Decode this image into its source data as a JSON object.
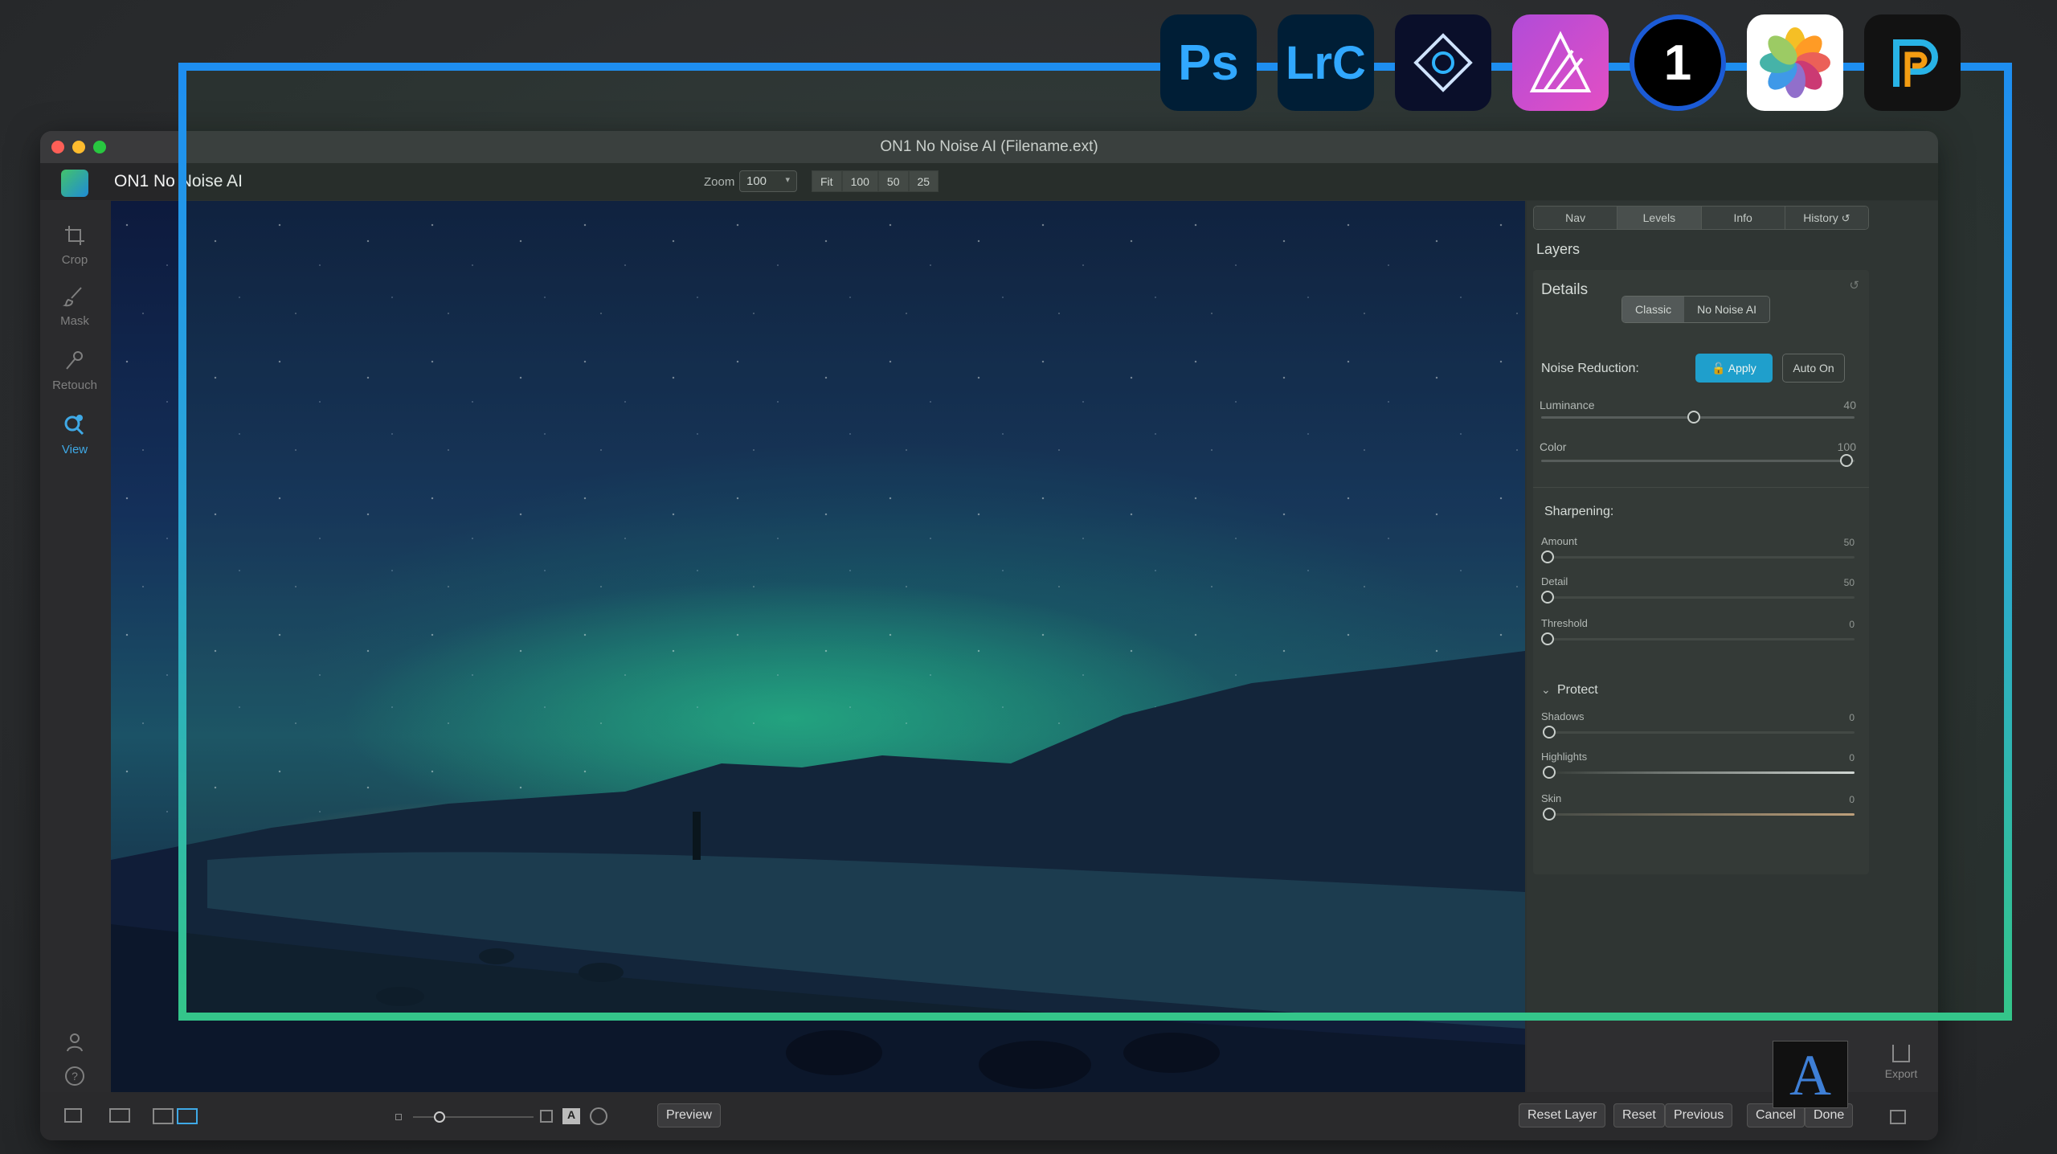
{
  "window": {
    "title": "ON1 No Noise AI (Filename.ext)",
    "app_name": "ON1 No Noise AI"
  },
  "zoom": {
    "label": "Zoom",
    "value": "100",
    "buttons": [
      "Fit",
      "100",
      "50",
      "25"
    ]
  },
  "left_tools": [
    {
      "label": "Crop",
      "icon": "crop-icon"
    },
    {
      "label": "Mask",
      "icon": "brush-icon"
    },
    {
      "label": "Retouch",
      "icon": "retouch-icon"
    },
    {
      "label": "View",
      "icon": "zoom-icon"
    }
  ],
  "panel": {
    "tabs": [
      "Nav",
      "Levels",
      "Info",
      "History"
    ],
    "active_tab": "Levels",
    "layers_heading": "Layers",
    "details_heading": "Details",
    "mode": {
      "options": [
        "Classic",
        "No Noise AI"
      ],
      "selected": "Classic"
    },
    "noise_reduction": {
      "label": "Noise Reduction:",
      "apply": "Apply",
      "auto_on": "Auto On",
      "luminance": {
        "label": "Luminance",
        "value": "40"
      },
      "color": {
        "label": "Color",
        "value": "100"
      }
    },
    "sharpening": {
      "label": "Sharpening:",
      "amount": {
        "label": "Amount",
        "value": "50"
      },
      "detail": {
        "label": "Detail",
        "value": "50"
      },
      "threshold": {
        "label": "Threshold",
        "value": "0"
      }
    },
    "protect": {
      "label": "Protect",
      "shadows": {
        "label": "Shadows",
        "value": "0"
      },
      "highlights": {
        "label": "Highlights",
        "value": "0"
      },
      "skin": {
        "label": "Skin",
        "value": "0"
      }
    }
  },
  "bottom": {
    "preview": "Preview",
    "reset_layer": "Reset Layer",
    "reset": "Reset",
    "previous": "Previous",
    "cancel": "Cancel",
    "done": "Done",
    "export": "Export"
  },
  "hosts": [
    {
      "label": "Ps",
      "icon": "photoshop-icon"
    },
    {
      "label": "LrC",
      "icon": "lightroom-classic-icon"
    },
    {
      "label": "",
      "icon": "photoshop-elements-icon"
    },
    {
      "label": "",
      "icon": "affinity-photo-icon"
    },
    {
      "label": "1",
      "icon": "capture-one-icon"
    },
    {
      "label": "",
      "icon": "apple-photos-icon"
    },
    {
      "label": "",
      "icon": "paintshop-pro-icon"
    }
  ],
  "colors": {
    "accent": "#1da1d6",
    "frame_top": "#1e8ef0",
    "frame_bottom": "#34c58a"
  }
}
